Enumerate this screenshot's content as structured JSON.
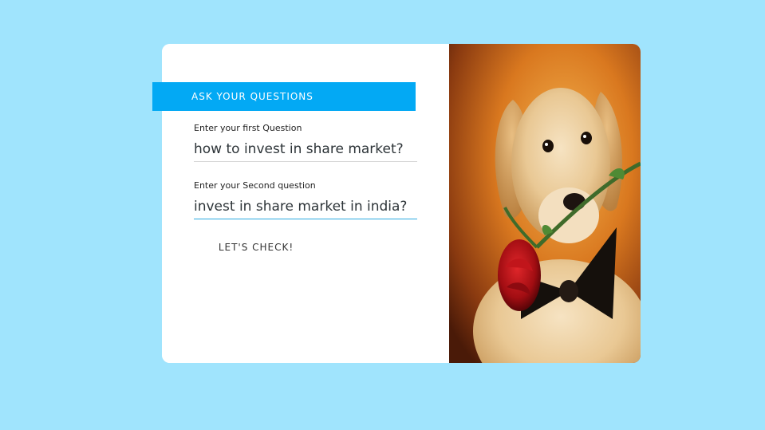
{
  "form": {
    "heading": "ASK YOUR QUESTIONS",
    "first_question": {
      "label": "Enter your first Question",
      "value": "how to invest in share market?"
    },
    "second_question": {
      "label": "Enter your Second question",
      "value": "invest in share market in india?"
    },
    "submit_label": "LET'S CHECK!"
  },
  "colors": {
    "page_background": "#a0e4fd",
    "accent": "#03a9f4",
    "card_background": "#ffffff"
  },
  "image": {
    "subject": "puppy-with-rose-photo"
  }
}
